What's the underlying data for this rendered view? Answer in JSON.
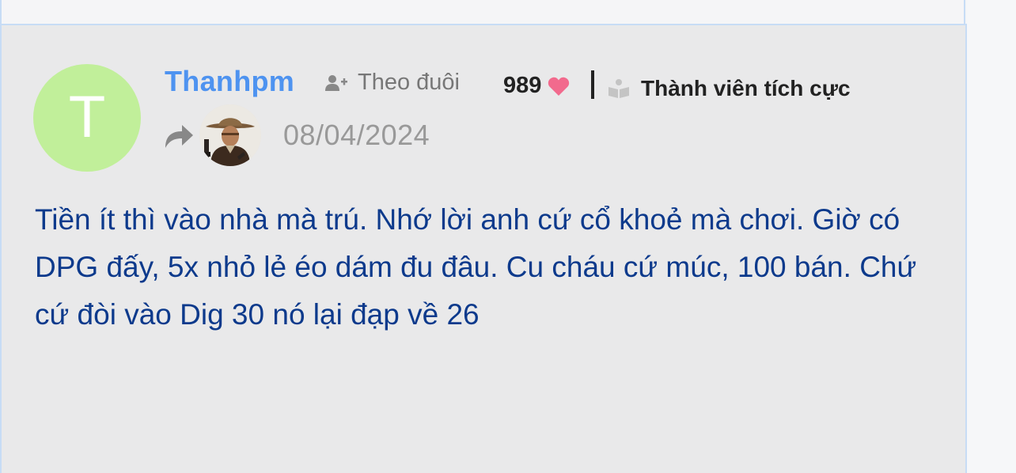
{
  "post": {
    "avatar_initial": "T",
    "username": "Thanhpm",
    "follow_label": "Theo đuôi",
    "points": "989",
    "rank_label": "Thành viên tích cực",
    "date": "08/04/2024",
    "body": "Tiền ít thì vào nhà mà trú. Nhớ lời anh cứ cổ khoẻ mà chơi. Giờ có DPG đấy, 5x nhỏ lẻ éo dám đu đâu. Cu cháu cứ múc, 100 bán. Chứ cứ đòi vào Dig 30 nó lại đạp về 26"
  },
  "icons": {
    "follow": "user-plus-icon",
    "points": "heart-icon",
    "rank": "book-icon",
    "reply": "share-arrow-icon"
  },
  "colors": {
    "username": "#4e93f0",
    "avatar_bg": "#c1ef9a",
    "heart": "#f26a8d",
    "body_text": "#0d3a8c",
    "card_bg": "#e9e9ea",
    "card_border": "#c7dcf5"
  }
}
